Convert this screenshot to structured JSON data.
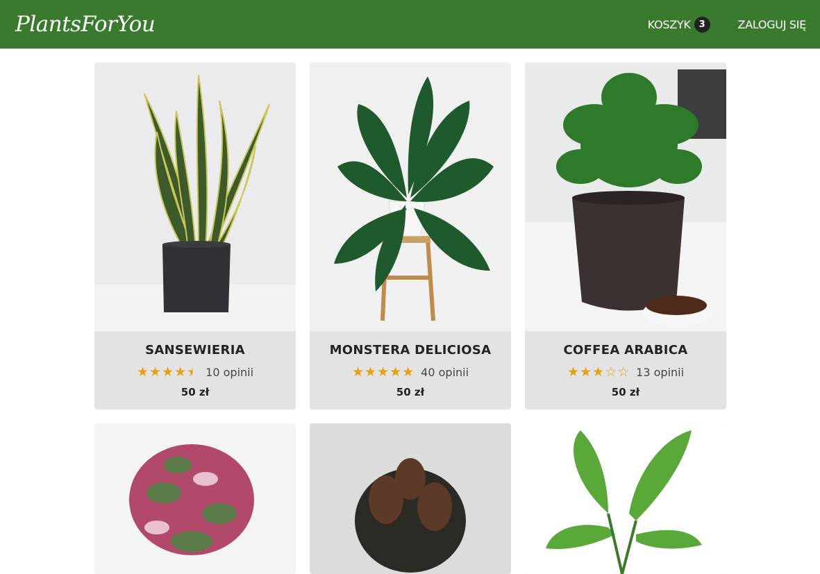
{
  "navbar": {
    "brand": "PlantsForYou",
    "cart_label": "KOSZYK",
    "cart_count": "3",
    "login_label": "ZALOGUJ SIĘ"
  },
  "colors": {
    "navbar": "#3a7a2f",
    "star": "#e0a21a",
    "card": "#e3e3e3"
  },
  "products": [
    {
      "name": "SANSEWIERIA",
      "rating": 4.5,
      "reviews": "10 opinii",
      "price": "50 zł"
    },
    {
      "name": "MONSTERA DELICIOSA",
      "rating": 5,
      "reviews": "40 opinii",
      "price": "50 zł"
    },
    {
      "name": "COFFEA ARABICA",
      "rating": 3,
      "reviews": "13 opinii",
      "price": "50 zł"
    }
  ]
}
